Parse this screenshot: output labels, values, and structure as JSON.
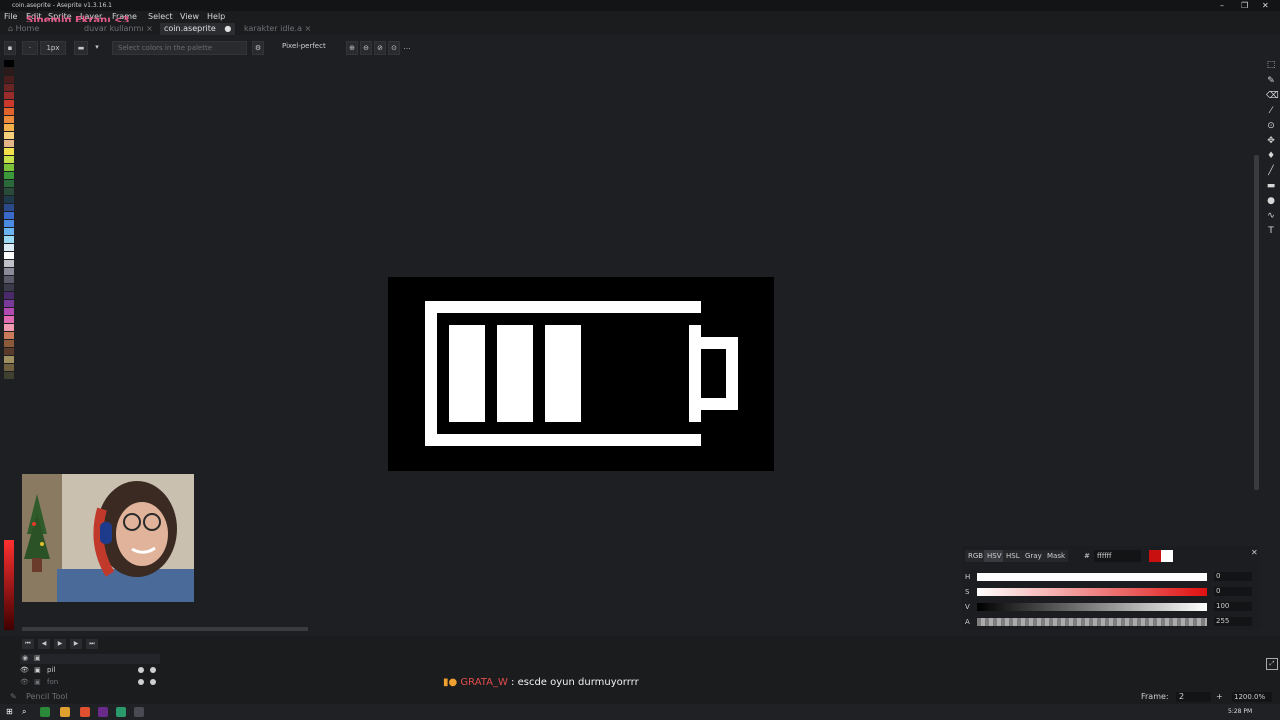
{
  "window": {
    "title": "coin.aseprite - Aseprite v1.3.16.1",
    "controls": [
      "–",
      "❐",
      "✕"
    ]
  },
  "menu": [
    "File",
    "Edit",
    "Sprite",
    "Layer",
    "Frame",
    "Select",
    "View",
    "Help"
  ],
  "overlay_text": "Sinemin Ekranı <3",
  "tabs": [
    {
      "label": "Home",
      "active": false
    },
    {
      "label": "duvar kullanmı",
      "active": false
    },
    {
      "label": "coin.aseprite",
      "active": true
    },
    {
      "label": "karakter idle.a",
      "active": false
    }
  ],
  "toolbar": {
    "brush_size": "1px",
    "palette_placeholder": "Select colors in the palette",
    "pixel_perfect_label": "Pixel-perfect"
  },
  "colors": {
    "fg": "#ffffff",
    "bg": "#c81010",
    "accent": "#e35a8a"
  },
  "color_panel": {
    "tabs": [
      "RGB",
      "HSV",
      "HSL",
      "Gray",
      "Mask"
    ],
    "hash": "#",
    "hex": "ffffff",
    "sliders": [
      {
        "label": "H",
        "value": "0"
      },
      {
        "label": "S",
        "value": "0"
      },
      {
        "label": "V",
        "value": "100"
      },
      {
        "label": "A",
        "value": "255"
      }
    ]
  },
  "timeline": {
    "layers": [
      {
        "name": "pil"
      },
      {
        "name": "fon"
      }
    ]
  },
  "chat": {
    "user": "GRATA_W",
    "separator": ":",
    "message": "escde oyun durmuyorrrr"
  },
  "status": {
    "tool": "Pencil Tool",
    "frame_label": "Frame:",
    "frame_value": "2",
    "zoom": "1200.0%"
  },
  "taskbar": {
    "time": "5:28 PM"
  }
}
